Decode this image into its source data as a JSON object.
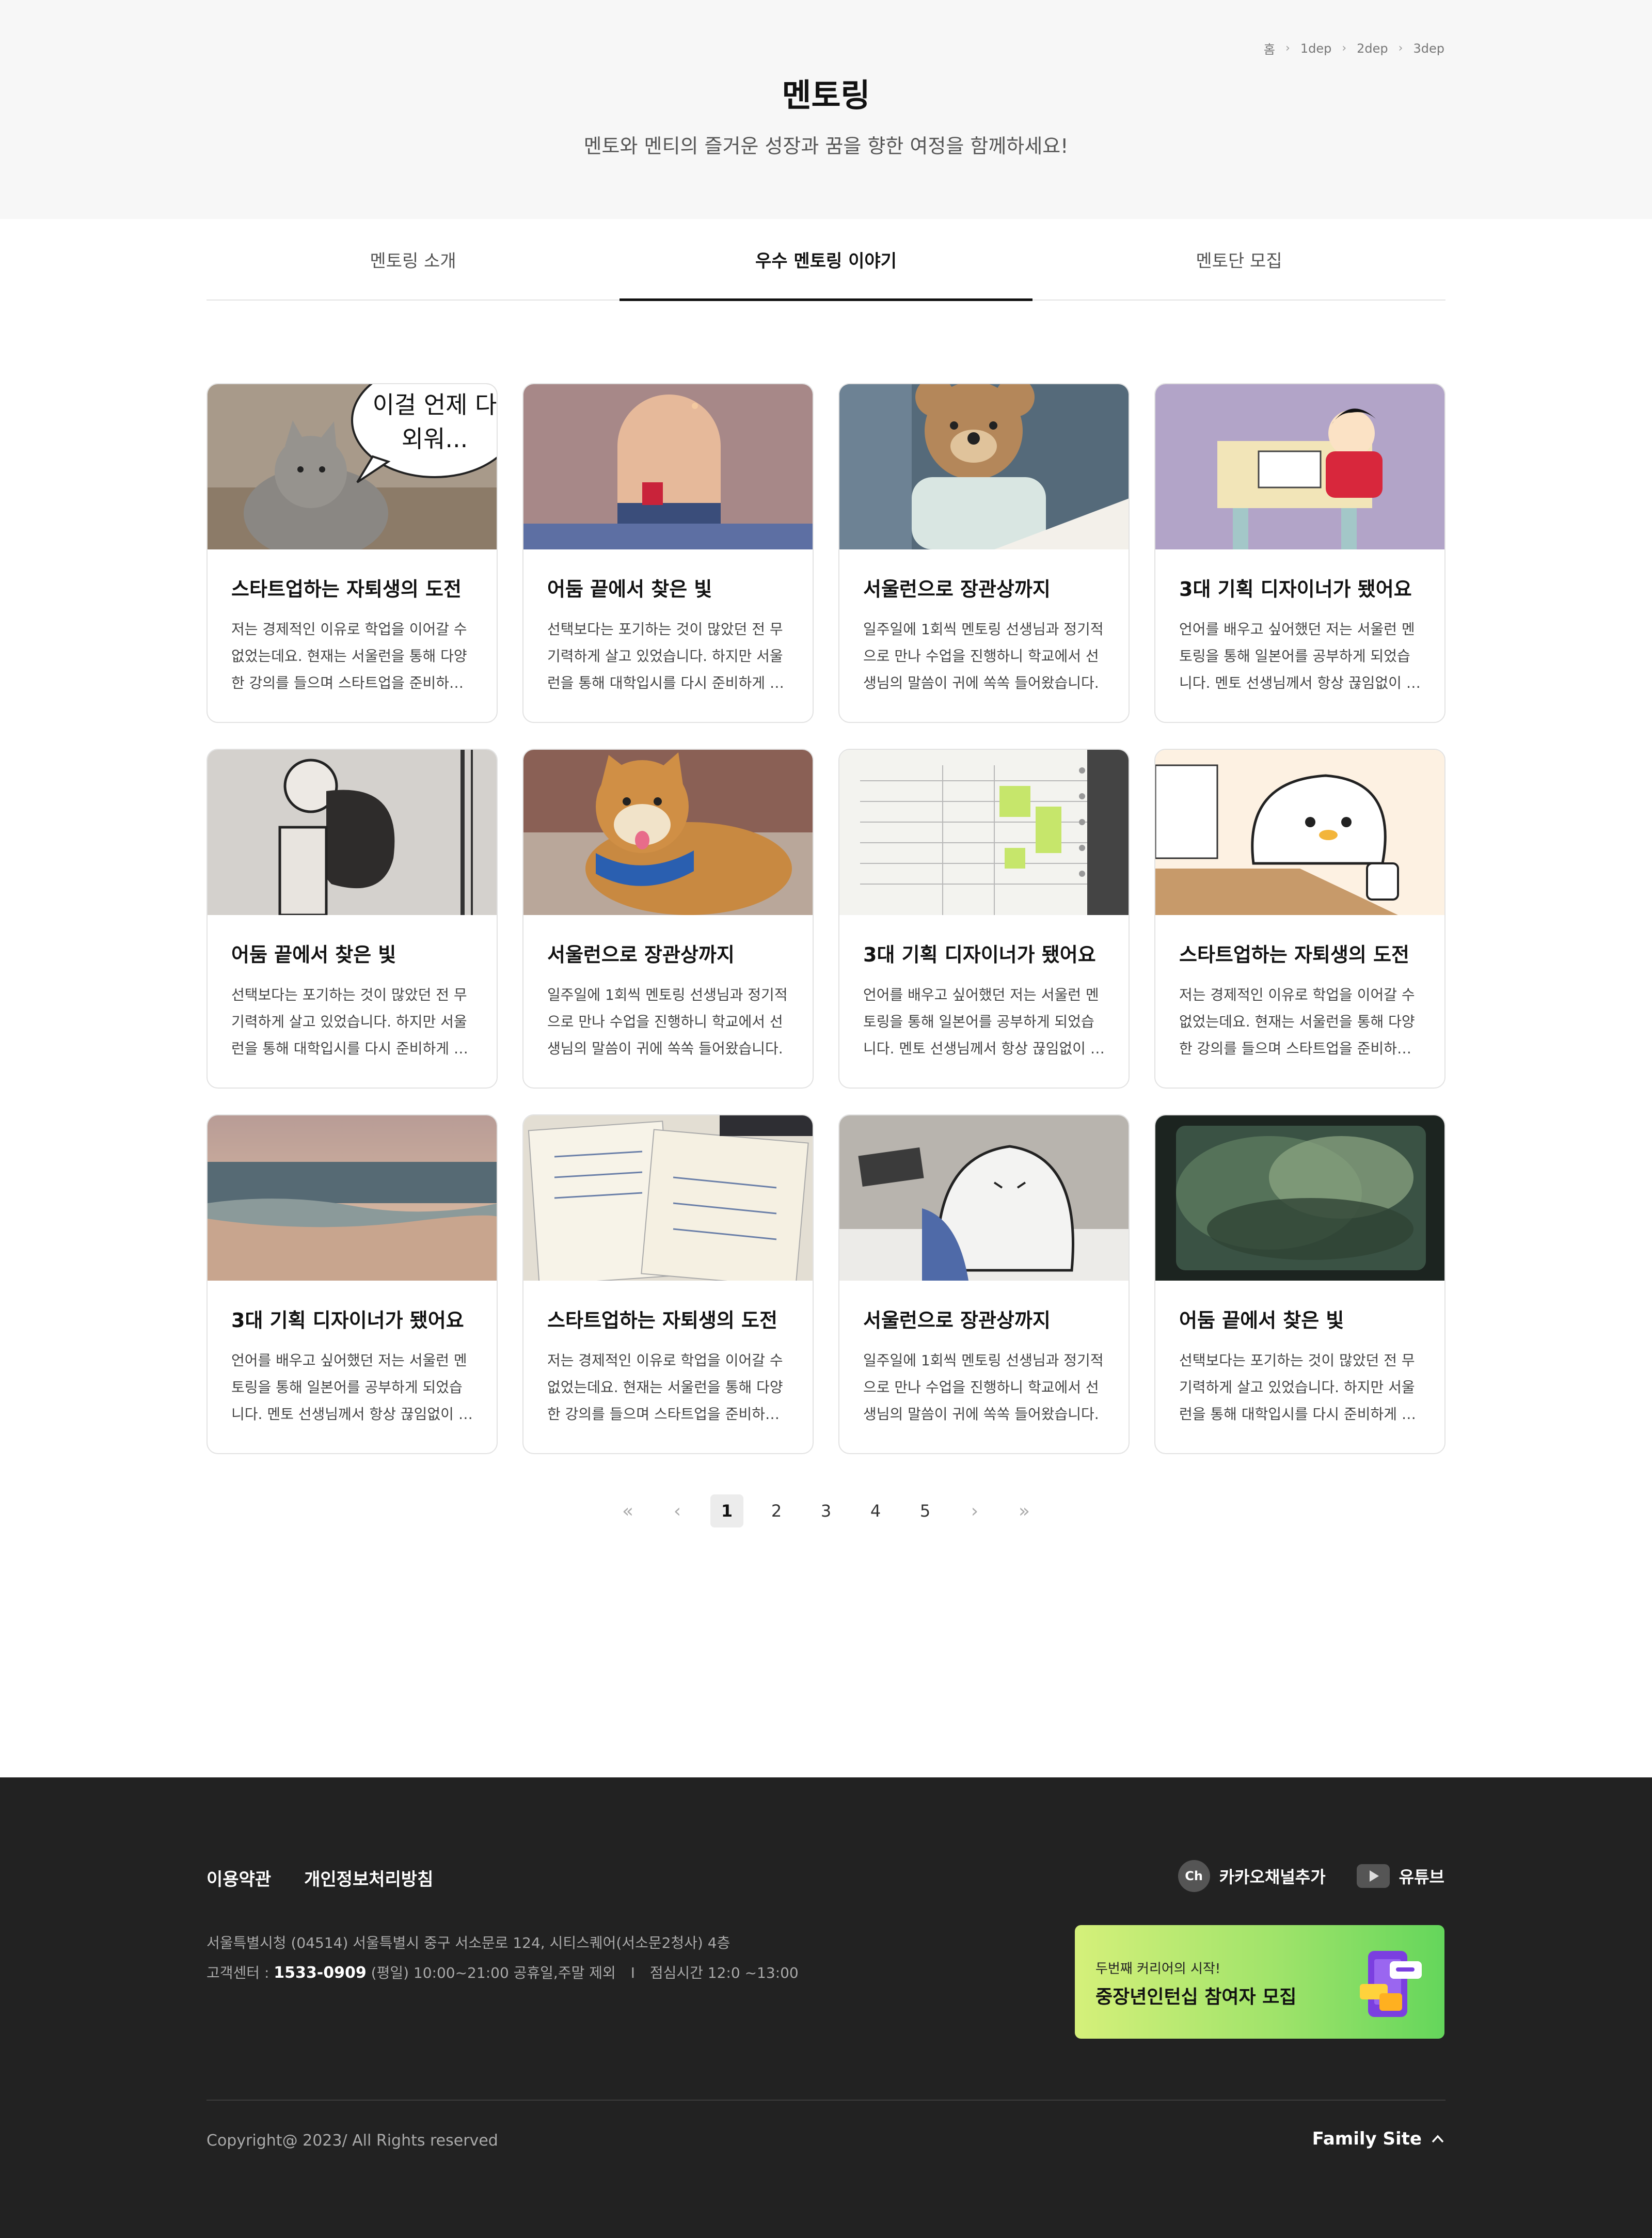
{
  "breadcrumb": [
    "홈",
    "1dep",
    "2dep",
    "3dep"
  ],
  "header": {
    "title": "멘토링",
    "subtitle": "멘토와 멘티의 즐거운 성장과 꿈을 향한 여정을 함께하세요!"
  },
  "tabs": [
    {
      "label": "멘토링 소개",
      "active": false
    },
    {
      "label": "우수 멘토링 이야기",
      "active": true
    },
    {
      "label": "멘토단 모집",
      "active": false
    }
  ],
  "cards": [
    {
      "title": "스타트업하는 자퇴생의 도전",
      "desc": "저는 경제적인 이유로 학업을 이어갈 수 없었는데요. 현재는 서울런을 통해 다양한 강의를 들으며 스타트업을 준비하고 있습니다.",
      "thumb": "cat-speech",
      "bubble": "이걸 언제 다 외워..."
    },
    {
      "title": "어둠 끝에서 찾은 빛",
      "desc": "선택보다는 포기하는 것이 많았던 전 무기력하게 살고 있었습니다. 하지만 서울런을 통해 대학입시를 다시 준비하게 되었습니다.",
      "thumb": "sunset-arch"
    },
    {
      "title": "서울런으로 장관상까지",
      "desc": "일주일에 1회씩 멘토링 선생님과 정기적으로 만나 수업을 진행하니 학교에서 선생님의 말씀이 귀에 쏙쏙 들어왔습니다.",
      "thumb": "teddy-bear"
    },
    {
      "title": "3대 기획 디자이너가 됐어요",
      "desc": "언어를 배우고 싶어했던 저는 서울런 멘토링을 통해 일본어를 공부하게 되었습니다. 멘토 선생님께서 항상 끊임없이 응원해주셨어요.",
      "thumb": "cartoon-desk"
    },
    {
      "title": "어둠 끝에서 찾은 빛",
      "desc": "선택보다는 포기하는 것이 많았던 전 무기력하게 살고 있었습니다. 하지만 서울런을 통해 대학입시를 다시 준비하게 되었습니다.",
      "thumb": "sketch-figure"
    },
    {
      "title": "서울런으로 장관상까지",
      "desc": "일주일에 1회씩 멘토링 선생님과 정기적으로 만나 수업을 진행하니 학교에서 선생님의 말씀이 귀에 쏙쏙 들어왔습니다.",
      "thumb": "shiba-dog"
    },
    {
      "title": "3대 기획 디자이너가 됐어요",
      "desc": "언어를 배우고 싶어했던 저는 서울런 멘토링을 통해 일본어를 공부하게 되었습니다. 멘토 선생님께서 항상 끊임없이 응원해주셨어요.",
      "thumb": "planner"
    },
    {
      "title": "스타트업하는 자퇴생의 도전",
      "desc": "저는 경제적인 이유로 학업을 이어갈 수 없었는데요. 현재는 서울런을 통해 다양한 강의를 들으며 스타트업을 준비하고 있습니다.",
      "thumb": "blob-character"
    },
    {
      "title": "3대 기획 디자이너가 됐어요",
      "desc": "언어를 배우고 싶어했던 저는 서울런 멘토링을 통해 일본어를 공부하게 되었습니다. 멘토 선생님께서 항상 끊임없이 응원해주셨어요.",
      "thumb": "beach"
    },
    {
      "title": "스타트업하는 자퇴생의 도전",
      "desc": "저는 경제적인 이유로 학업을 이어갈 수 없었는데요. 현재는 서울런을 통해 다양한 강의를 들으며 스타트업을 준비하고 있습니다.",
      "thumb": "notebooks"
    },
    {
      "title": "서울런으로 장관상까지",
      "desc": "일주일에 1회씩 멘토링 선생님과 정기적으로 만나 수업을 진행하니 학교에서 선생님의 말씀이 귀에 쏙쏙 들어왔습니다.",
      "thumb": "sleepy-character"
    },
    {
      "title": "어둠 끝에서 찾은 빛",
      "desc": "선택보다는 포기하는 것이 많았던 전 무기력하게 살고 있었습니다. 하지만 서울런을 통해 대학입시를 다시 준비하게 되었습니다.",
      "thumb": "blurry-tv"
    }
  ],
  "pagination": {
    "first_icon": "double-chevron-left-icon",
    "prev_icon": "chevron-left-icon",
    "pages": [
      "1",
      "2",
      "3",
      "4",
      "5"
    ],
    "current": "1",
    "next_icon": "chevron-right-icon",
    "last_icon": "double-chevron-right-icon"
  },
  "footer": {
    "links": [
      "이용약관",
      "개인정보처리방침"
    ],
    "kakao": {
      "icon_text": "Ch",
      "label": "카카오채널추가"
    },
    "youtube": {
      "label": "유튜브"
    },
    "address": "서울특별시청 (04514) 서울특별시 중구 서소문로 124, 시티스퀘어(서소문2청사) 4층",
    "contact_prefix": "고객센터 :",
    "phone": "1533-0909",
    "hours": "(평일) 10:00~21:00 공휴일,주말 제외",
    "contact_divider": "I",
    "lunch": "점심시간 12:0 ~13:00",
    "banner": {
      "small": "두번째 커리어의 시작!",
      "big": "중장년인턴십 참여자 모집"
    },
    "copyright": "Copyright@ 2023/ All Rights reserved",
    "family_site": "Family Site"
  }
}
